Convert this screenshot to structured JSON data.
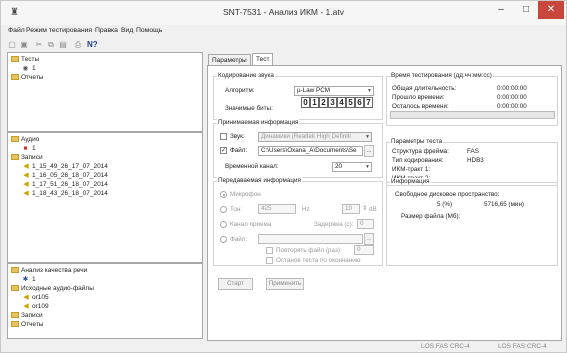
{
  "window": {
    "title": "SNT-7531 - Анализ ИКМ - 1.atv",
    "minimize": "–",
    "maximize": "□",
    "close": "✕"
  },
  "menu": [
    "Файл",
    "Режим тестирования",
    "Правка",
    "Вид",
    "Помощь"
  ],
  "toolbar_icons": [
    "new-file-icon",
    "save-icon",
    "cut-icon",
    "copy-icon",
    "paste-icon",
    "print-icon",
    "help-icon"
  ],
  "tree_top": [
    {
      "label": "Тесты",
      "kind": "folder"
    },
    {
      "label": "1",
      "kind": "test"
    },
    {
      "label": "Отчеты",
      "kind": "folder"
    }
  ],
  "tree_middle": [
    {
      "label": "Аудио",
      "kind": "folder"
    },
    {
      "label": "1",
      "kind": "test"
    },
    {
      "label": "Записи",
      "kind": "folder"
    },
    {
      "label": "1_15_49_26_17_07_2014",
      "kind": "audio"
    },
    {
      "label": "1_16_05_26_18_07_2014",
      "kind": "audio"
    },
    {
      "label": "1_17_51_26_18_07_2014",
      "kind": "audio"
    },
    {
      "label": "1_18_43_26_18_07_2014",
      "kind": "audio"
    }
  ],
  "tree_bottom": [
    {
      "label": "Анализ качества речи",
      "kind": "folder"
    },
    {
      "label": "1",
      "kind": "test"
    },
    {
      "label": "Исходные аудио-файлы",
      "kind": "folder"
    },
    {
      "label": "or105",
      "kind": "audio"
    },
    {
      "label": "or109",
      "kind": "audio"
    },
    {
      "label": "Записи",
      "kind": "folder"
    },
    {
      "label": "Отчеты",
      "kind": "folder"
    }
  ],
  "tabs": [
    "Параметры",
    "Тест"
  ],
  "coding": {
    "group": "Кодирование звука",
    "algo_label": "Алгоритм:",
    "algo_value": "µ-Law PCM",
    "bits_label": "Значимые биты:",
    "bits": [
      "0",
      "1",
      "2",
      "3",
      "4",
      "5",
      "6",
      "7"
    ]
  },
  "receive": {
    "group": "Принимаемая информация",
    "sound_label": "Звук:",
    "sound_value": "Динамики (Realtek High Definiti",
    "file_label": "Файл:",
    "file_value": "C:\\Users\\Oxana_A\\Documents\\Se",
    "browse": "...",
    "channel_label": "Временной канал:",
    "channel_value": "20"
  },
  "transmit": {
    "group": "Передаваемая информация",
    "mic": "Микрофон",
    "tone": "Тон:",
    "tone_value": "425",
    "hz": "Hz",
    "level_value": "10",
    "db": "dB",
    "reception_channel": "Канал приема",
    "delay_label": "Задержка (с):",
    "delay_value": "0",
    "file": "Файл:",
    "browse": "...",
    "repeat_label": "Повторять файл (раз):",
    "repeat_value": "0",
    "stop_label": "Останов теста по окончанию"
  },
  "time": {
    "group": "Время тестирования (дд:чч:мм:сс)",
    "total_label": "Общая длительность:",
    "total_value": "0:00:00:00",
    "elapsed_label": "Прошло времени:",
    "elapsed_value": "0:00:00:00",
    "remaining_label": "Осталось времени:",
    "remaining_value": "0:00:00:00"
  },
  "test_params": {
    "group": "Параметры теста",
    "frame_label": "Структура фрейма:",
    "frame_value": "FAS",
    "coding_label": "Тип кодирования:",
    "coding_value": "HDB3",
    "path1": "ИКМ-тракт 1:",
    "path2": "ИКМ-тракт 2:"
  },
  "info": {
    "group": "Информация",
    "free_label": "Свободное дисковое пространство:",
    "free_pct": "5 (%)",
    "free_time": "5716,65 (мин)",
    "size_label": "Размер файла (Мб):"
  },
  "buttons": {
    "start": "Старт",
    "apply": "Применить"
  },
  "status": {
    "left": "LOS  FAS  CRC-4",
    "right": "LOS  FAS  CRC-4"
  }
}
